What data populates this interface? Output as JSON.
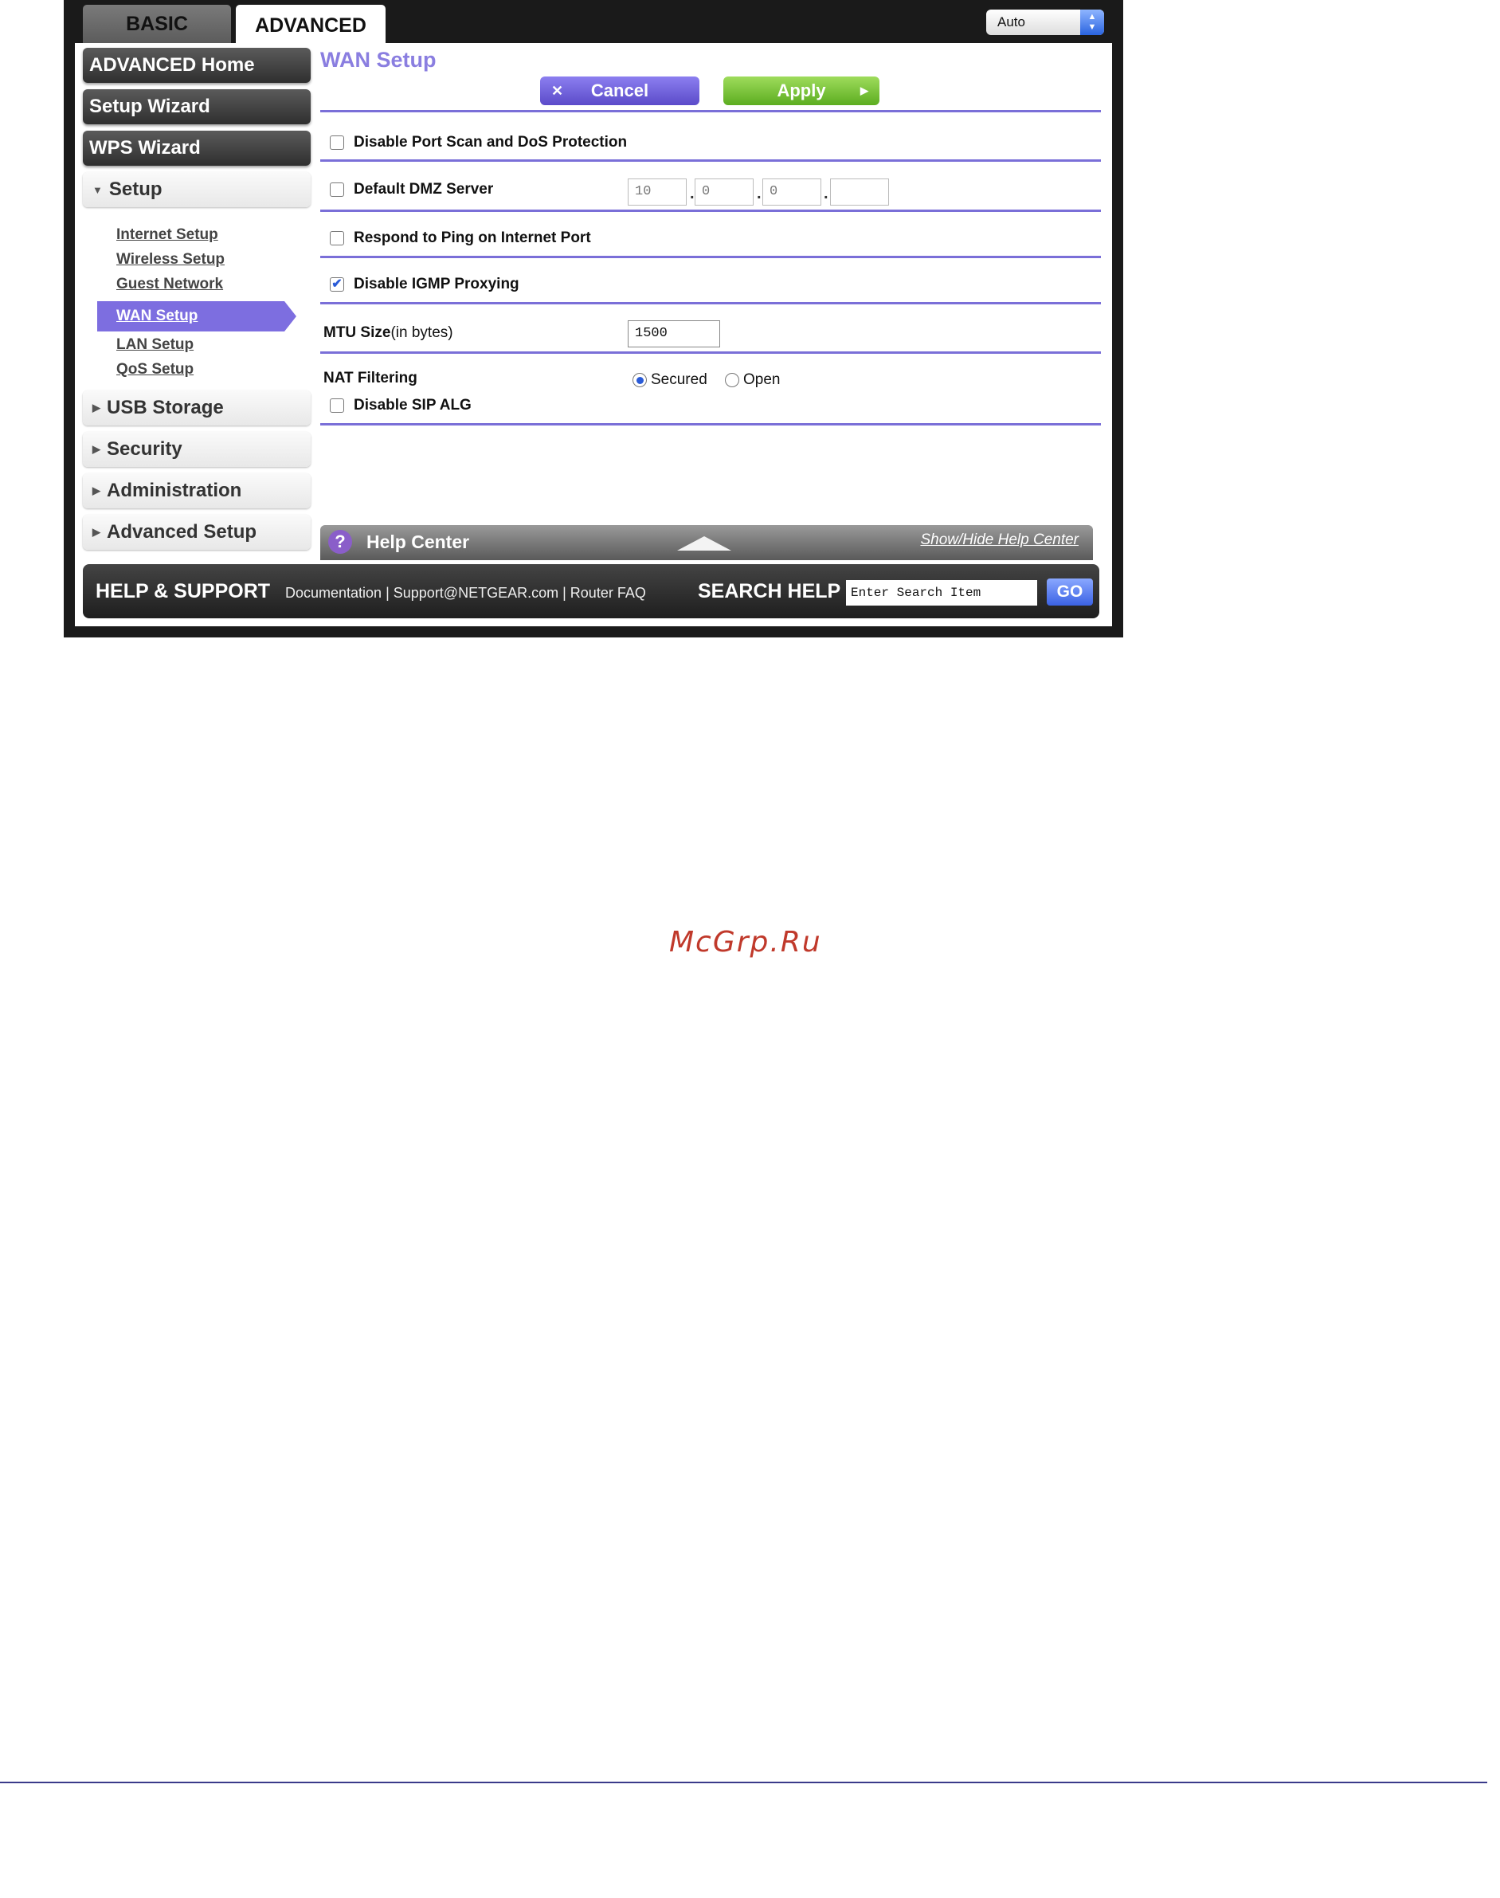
{
  "tabs": {
    "basic": "BASIC",
    "advanced": "ADVANCED"
  },
  "auto_select": {
    "value": "Auto"
  },
  "sidebar": {
    "advanced_home": "ADVANCED Home",
    "setup_wizard": "Setup Wizard",
    "wps_wizard": "WPS Wizard",
    "setup": "Setup",
    "sub_items": [
      "Internet Setup",
      "Wireless Setup",
      "Guest Network",
      "WAN Setup",
      "LAN Setup",
      "QoS Setup"
    ],
    "usb_storage": "USB Storage",
    "security": "Security",
    "administration": "Administration",
    "advanced_setup": "Advanced Setup"
  },
  "main": {
    "title": "WAN Setup",
    "cancel_label": "Cancel",
    "apply_label": "Apply",
    "disable_port_scan": "Disable Port Scan and DoS Protection",
    "default_dmz": "Default DMZ Server",
    "dmz_ip": [
      "10",
      "0",
      "0",
      ""
    ],
    "respond_ping": "Respond to Ping on Internet Port",
    "disable_igmp": "Disable IGMP Proxying",
    "mtu_label": "MTU Size",
    "mtu_unit": "(in bytes)",
    "mtu_value": "1500",
    "nat_label": "NAT Filtering",
    "nat_secured": "Secured",
    "nat_open": "Open",
    "disable_sip": "Disable SIP ALG"
  },
  "help": {
    "label": "Help Center",
    "toggle": "Show/Hide Help Center"
  },
  "footer": {
    "help_support": "HELP & SUPPORT",
    "links": [
      "Documentation",
      "Support@NETGEAR.com",
      "Router FAQ"
    ],
    "search_help": "SEARCH HELP",
    "search_placeholder": "Enter Search Item",
    "go": "GO"
  },
  "watermark": "McGrp.Ru"
}
